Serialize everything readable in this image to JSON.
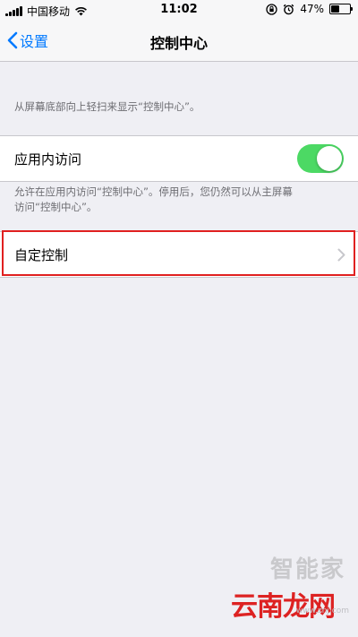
{
  "status_bar": {
    "carrier": "中国移动",
    "time": "11:02",
    "battery_percent": "47%",
    "battery_level": 0.47,
    "icons": [
      "signal-icon",
      "wifi-icon",
      "orientation-lock-icon",
      "alarm-icon",
      "battery-icon"
    ]
  },
  "nav": {
    "back_label": "设置",
    "title": "控制中心"
  },
  "intro_hint": "从屏幕底部向上轻扫来显示“控制中心”。",
  "access_within_apps": {
    "label": "应用内访问",
    "enabled": true,
    "hint_line1": "允许在应用内访问“控制中心”。停用后，您仍然可以从主屏幕",
    "hint_line2": "访问“控制中心”。"
  },
  "customize": {
    "label": "自定控制"
  },
  "colors": {
    "accent": "#007aff",
    "toggle_on": "#4cd964",
    "highlight": "#e02020",
    "background": "#efeff4"
  },
  "watermark": {
    "top_text": "智能家",
    "main_text": "云南龙网",
    "small_text": "www.znj.com"
  }
}
